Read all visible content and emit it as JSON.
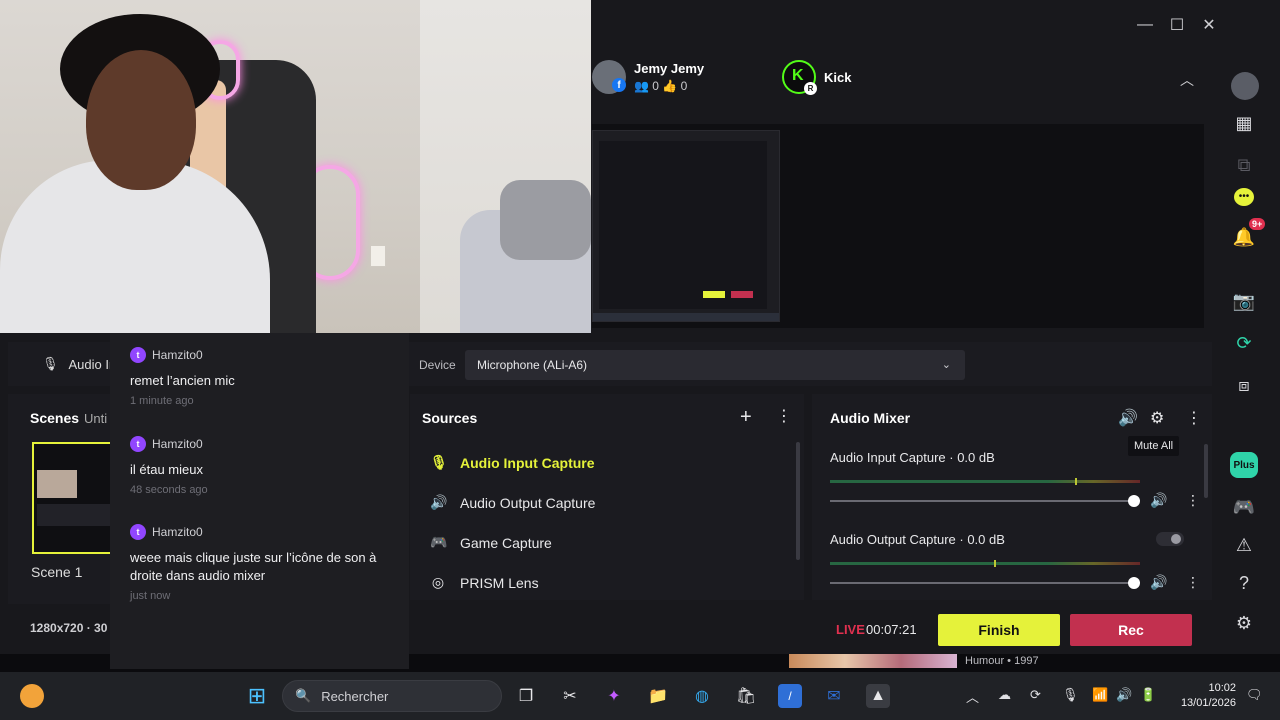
{
  "window": {
    "minimize": "—",
    "maximize": "☐",
    "close": "✕"
  },
  "channels": [
    {
      "name": "Jemy Jemy",
      "viewers": "0",
      "likes": "0",
      "platform": "facebook"
    },
    {
      "name": "Kick",
      "platform": "kick"
    }
  ],
  "rail": {
    "notif_badge": "9+",
    "plus_label": "Plus"
  },
  "device_row": {
    "source_label": "Audio Inp",
    "device_label": "Device",
    "device_value": "Microphone (ALi-A6)"
  },
  "scenes": {
    "title": "Scenes",
    "collection": "Unti",
    "scene_name": "Scene 1",
    "resolution": "1280x720 · 30"
  },
  "sources": {
    "title": "Sources",
    "items": [
      {
        "label": "Audio Input Capture",
        "icon": "microphone-icon",
        "active": true
      },
      {
        "label": "Audio Output Capture",
        "icon": "speaker-icon",
        "active": false
      },
      {
        "label": "Game Capture",
        "icon": "gamepad-icon",
        "active": false
      },
      {
        "label": "PRISM Lens",
        "icon": "lens-icon",
        "active": false
      }
    ]
  },
  "mixer": {
    "title": "Audio Mixer",
    "tooltip": "Mute All",
    "channels": [
      {
        "name": "Audio Input Capture",
        "db": "0.0 dB",
        "meter_level": 0.79,
        "volume": 1.0
      },
      {
        "name": "Audio Output Capture",
        "db": "0.0 dB",
        "meter_level": 0.53,
        "volume": 1.0
      }
    ]
  },
  "footer": {
    "live_label": "LIVE",
    "timer": "00:07:21",
    "finish_label": "Finish",
    "rec_label": "Rec"
  },
  "bottom_strip": {
    "text": "Humour • 1997"
  },
  "chat": {
    "messages": [
      {
        "user": "Hamzito0",
        "text": "remet l’ancien mic",
        "time": "1 minute ago"
      },
      {
        "user": "Hamzito0",
        "text": "il étau mieux",
        "time": "48 seconds ago"
      },
      {
        "user": "Hamzito0",
        "text": "weee mais clique juste sur l’icône de son à droite dans audio mixer",
        "time": "just now"
      }
    ]
  },
  "taskbar": {
    "search_placeholder": "Rechercher",
    "time": "10:02",
    "date": "13/01/2026"
  },
  "colors": {
    "accent_yellow": "#e5f23a",
    "rec_red": "#c2304f",
    "live_red": "#e0304f",
    "twitch_purple": "#9146ff"
  }
}
